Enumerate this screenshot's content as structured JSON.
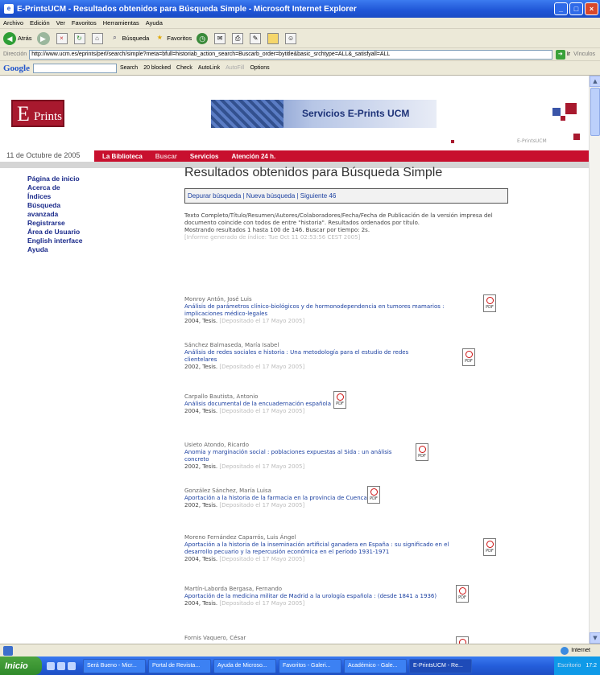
{
  "window": {
    "title": "E-PrintsUCM - Resultados obtenidos para Búsqueda Simple - Microsoft Internet Explorer"
  },
  "menu": [
    "Archivo",
    "Edición",
    "Ver",
    "Favoritos",
    "Herramientas",
    "Ayuda"
  ],
  "toolbar": {
    "back": "Atrás",
    "search": "Búsqueda",
    "favorites": "Favoritos"
  },
  "address": {
    "label": "Dirección",
    "url": "http://www.ucm.es/eprints/perl/search/simple?meta=bfull=historiab_action_search=Buscarb_order=bytitle&basic_srchtype=ALL&_satisfyall=ALL",
    "go": "Ir",
    "links": "Vínculos"
  },
  "googlebar": {
    "logo": "Google",
    "search": "Search",
    "blocked": "20 blocked",
    "check": "Check",
    "autolink": "AutoLink",
    "autofill": "AutoFill",
    "options": "Options"
  },
  "banner": {
    "logo_e": "E",
    "logo_p": "Prints",
    "title": "Servicios E-Prints UCM",
    "small": "E-PrintsUCM"
  },
  "nav": {
    "date": "11 de Octubre de 2005",
    "items": [
      "La Biblioteca",
      "Buscar",
      "Servicios",
      "Atención 24 h."
    ]
  },
  "sidebar": [
    "Página de inicio",
    "Acerca de",
    "Índices",
    "Búsqueda avanzada",
    "Registrarse",
    "Área de Usuario",
    "English interface",
    "Ayuda"
  ],
  "main": {
    "heading": "Resultados obtenidos para Búsqueda Simple",
    "actions": "Depurar búsqueda | Nueva búsqueda | Siguiente 46",
    "summary_1": "Texto Completo/Título/Resumen/Autores/Colaboradores/Fecha/Fecha de Publicación de la versión impresa del documento coincide con todos de entre \"historia\". Resultados ordenados por título.",
    "summary_2": "Mostrando resultados 1 hasta 100 de 146. Buscar por tiempo: 2s.",
    "summary_3": "[Informe generado de índice: Tue Oct 11 02:53:56 CEST 2005]"
  },
  "results": [
    {
      "author": "Monroy Antón, José Luis",
      "title": "Análisis de parámetros clínico-biológicos y de hormonodependencia en tumores mamarios : implicaciones médico-legales",
      "meta": "2004, Tesis.",
      "deposit": "[Depositado el 17 Mayo 2005]"
    },
    {
      "author": "Sánchez Balmaseda, María Isabel",
      "title": "Análisis de redes sociales e historia : Una metodología para el estudio de redes clientelares",
      "meta": "2002, Tesis.",
      "deposit": "[Depositado el 17 Mayo 2005]"
    },
    {
      "author": "Carpallo Bautista, Antonio",
      "title": "Análisis documental de la encuadernación española",
      "meta": "2004, Tesis.",
      "deposit": "[Depositado el 17 Mayo 2005]"
    },
    {
      "author": "Usieto Atondo, Ricardo",
      "title": "Anomia y marginación social : poblaciones expuestas al Sida : un análisis concreto",
      "meta": "2002, Tesis.",
      "deposit": "[Depositado el 17 Mayo 2005]"
    },
    {
      "author": "González Sánchez, María Luisa",
      "title": "Aportación a la historia de la farmacia en la provincia de Cuenca",
      "meta": "2002, Tesis.",
      "deposit": "[Depositado el 17 Mayo 2005]"
    },
    {
      "author": "Moreno Fernández Caparrós, Luis Ángel",
      "title": "Aportación a la historia de la inseminación artificial ganadera en España : su significado en el desarrollo pecuario y la repercusión económica en el período 1931-1971",
      "meta": "2004, Tesis.",
      "deposit": "[Depositado el 17 Mayo 2005]"
    },
    {
      "author": "Martín-Laborda Bergasa, Fernando",
      "title": "Aportación de la medicina militar de Madrid a la urología española : (desde 1841 a 1936)",
      "meta": "2004, Tesis.",
      "deposit": "[Depositado el 17 Mayo 2005]"
    },
    {
      "author": "Fornis Vaquero, César",
      "title": "",
      "meta": "",
      "deposit": ""
    }
  ],
  "pdf_label": "PDF",
  "status": {
    "zone": "Internet"
  },
  "taskbar": {
    "start": "Inicio",
    "tasks": [
      "Será Bueno - Micr...",
      "Portal de Revista...",
      "Ayuda de Microso...",
      "Favoritos - Galeri...",
      "Académico - Gale...",
      "E-PrintsUCM - Re..."
    ],
    "tray_label": "Escritorio",
    "clock": "17:2"
  }
}
